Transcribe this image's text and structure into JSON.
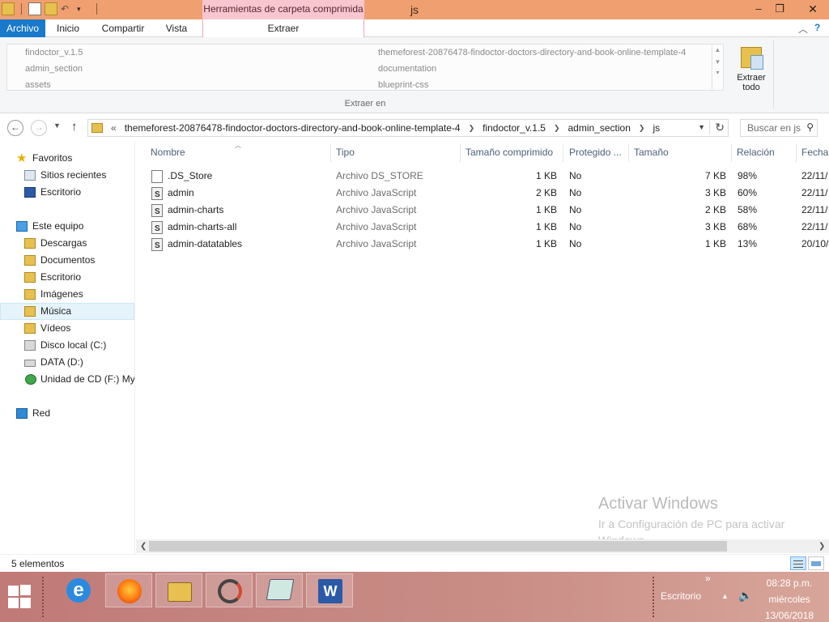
{
  "window": {
    "title": "js",
    "context_tab_header": "Herramientas de carpeta comprimida",
    "controls": {
      "minimize": "–",
      "maximize": "❐",
      "close": "✕"
    }
  },
  "ribbon_tabs": {
    "archivo": "Archivo",
    "inicio": "Inicio",
    "compartir": "Compartir",
    "vista": "Vista",
    "extraer": "Extraer"
  },
  "ribbon": {
    "destinations": [
      "findoctor_v.1.5",
      "admin_section",
      "assets",
      "themeforest-20876478-findoctor-doctors-directory-and-book-online-template-4",
      "documentation",
      "blueprint-css"
    ],
    "extract_all_line1": "Extraer",
    "extract_all_line2": "todo",
    "group_label": "Extraer en"
  },
  "address_bar": {
    "overflow": "«",
    "crumbs": [
      "themeforest-20876478-findoctor-doctors-directory-and-book-online-template-4",
      "findoctor_v.1.5",
      "admin_section",
      "js"
    ]
  },
  "search": {
    "placeholder": "Buscar en js"
  },
  "nav_pane": {
    "favoritos": "Favoritos",
    "sitios_recientes": "Sitios recientes",
    "escritorio_fav": "Escritorio",
    "este_equipo": "Este equipo",
    "descargas": "Descargas",
    "documentos": "Documentos",
    "escritorio": "Escritorio",
    "imagenes": "Imágenes",
    "musica": "Música",
    "videos": "Vídeos",
    "disco_c": "Disco local (C:)",
    "data_d": "DATA (D:)",
    "cd_f": "Unidad de CD (F:) My",
    "red": "Red"
  },
  "columns": {
    "nombre": "Nombre",
    "tipo": "Tipo",
    "tamano_comprimido": "Tamaño comprimido",
    "protegido": "Protegido ...",
    "tamano": "Tamaño",
    "relacion": "Relación",
    "fecha": "Fecha"
  },
  "files": [
    {
      "name": ".DS_Store",
      "type": "Archivo DS_STORE",
      "compressed": "1 KB",
      "protected": "No",
      "size": "7 KB",
      "ratio": "98%",
      "date": "22/11/",
      "icon": "generic-file-icon"
    },
    {
      "name": "admin",
      "type": "Archivo JavaScript",
      "compressed": "2 KB",
      "protected": "No",
      "size": "3 KB",
      "ratio": "60%",
      "date": "22/11/",
      "icon": "js-file-icon"
    },
    {
      "name": "admin-charts",
      "type": "Archivo JavaScript",
      "compressed": "1 KB",
      "protected": "No",
      "size": "2 KB",
      "ratio": "58%",
      "date": "22/11/",
      "icon": "js-file-icon"
    },
    {
      "name": "admin-charts-all",
      "type": "Archivo JavaScript",
      "compressed": "1 KB",
      "protected": "No",
      "size": "3 KB",
      "ratio": "68%",
      "date": "22/11/",
      "icon": "js-file-icon"
    },
    {
      "name": "admin-datatables",
      "type": "Archivo JavaScript",
      "compressed": "1 KB",
      "protected": "No",
      "size": "1 KB",
      "ratio": "13%",
      "date": "20/10/",
      "icon": "js-file-icon"
    }
  ],
  "watermark": {
    "line1": "Activar Windows",
    "line2": "Ir a Configuración de PC para activar Windows."
  },
  "status": {
    "count": "5 elementos"
  },
  "taskbar": {
    "tray_label": "Escritorio",
    "chevron": "»",
    "time": "08:28 p.m.",
    "day": "miércoles",
    "date": "13/06/2018"
  },
  "colors": {
    "title_bar": "#f0a070",
    "context_tab": "#f7c6cf",
    "archivo_tab": "#1979ca",
    "selection": "#e5f3fb"
  }
}
